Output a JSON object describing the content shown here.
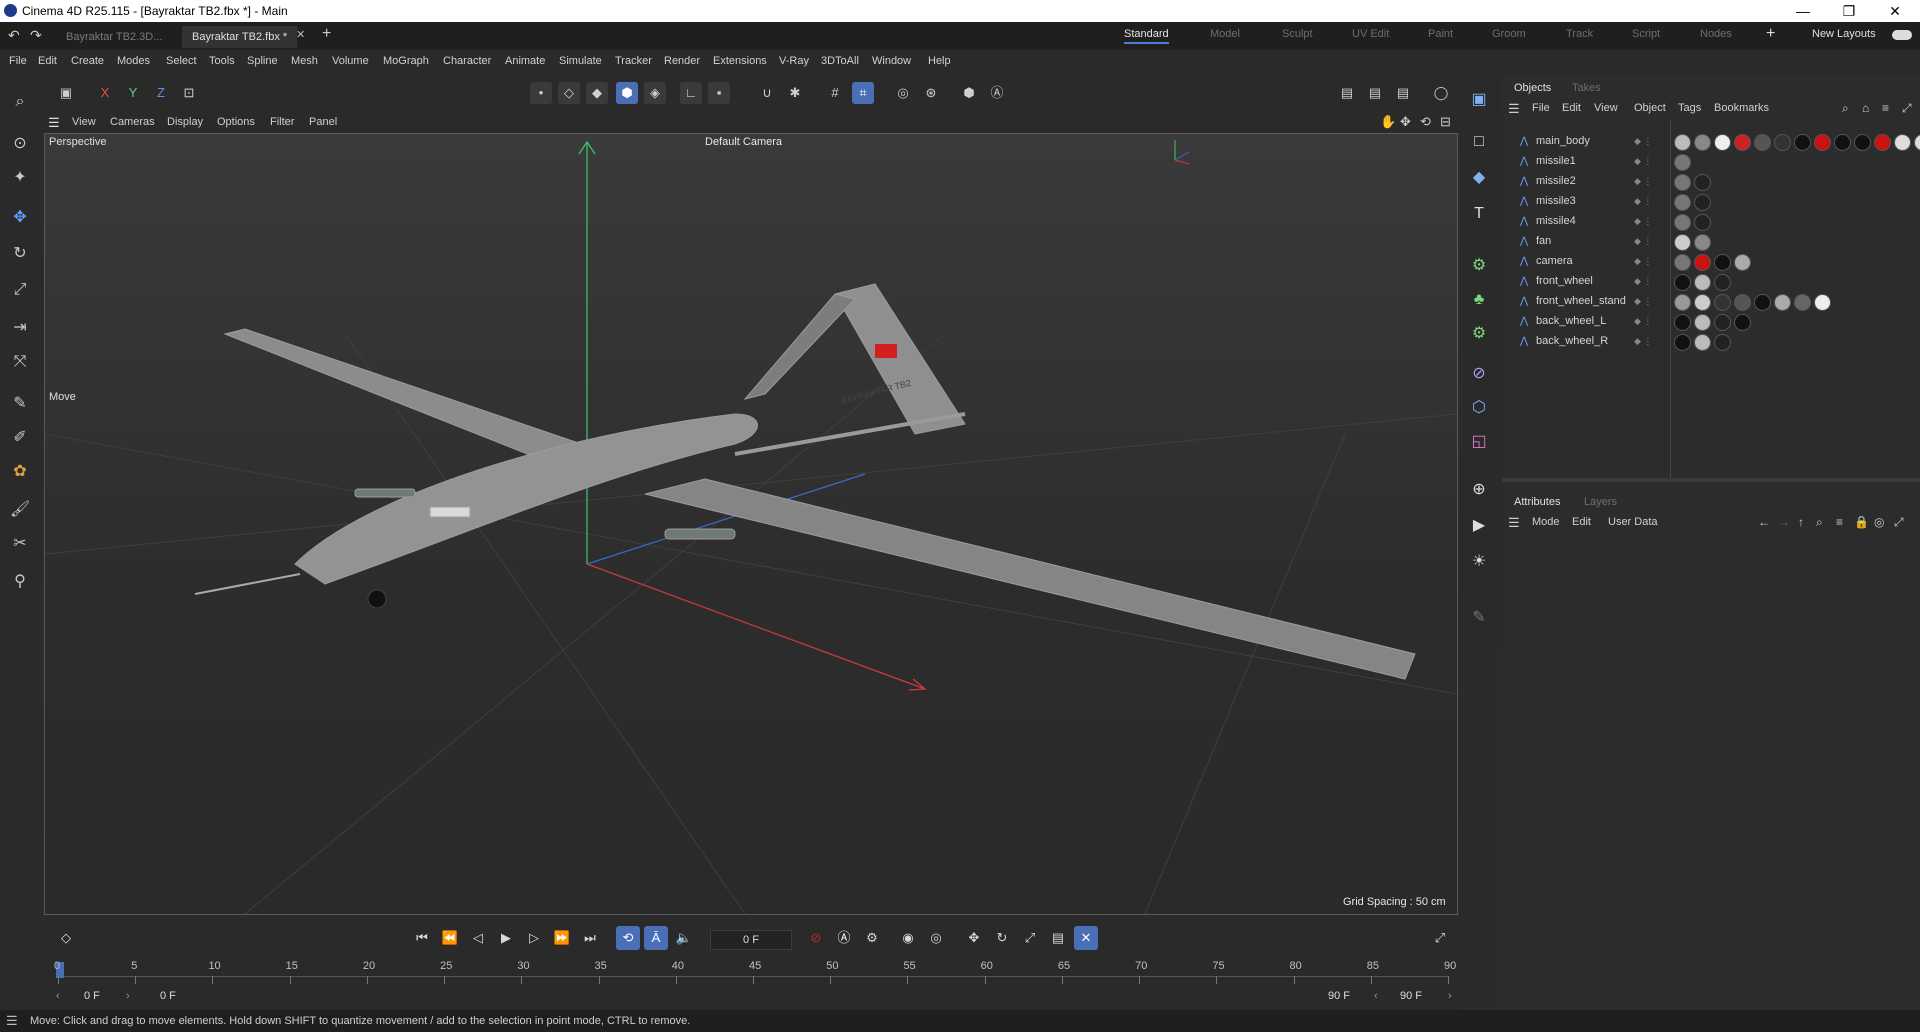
{
  "window": {
    "title": "Cinema 4D R25.115 - [Bayraktar TB2.fbx *] - Main",
    "minimize": "—",
    "maximize": "❐",
    "close": "✕"
  },
  "doc_tabs": [
    {
      "label": "Bayraktar TB2.3D..."
    },
    {
      "label": "Bayraktar TB2.fbx *"
    }
  ],
  "layout_tabs": [
    "Standard",
    "Model",
    "Sculpt",
    "UV Edit",
    "Paint",
    "Groom",
    "Track",
    "Script",
    "Nodes"
  ],
  "new_layouts": "New Layouts",
  "menu": [
    "File",
    "Edit",
    "Create",
    "Modes",
    "Select",
    "Tools",
    "Spline",
    "Mesh",
    "Volume",
    "MoGraph",
    "Character",
    "Animate",
    "Simulate",
    "Tracker",
    "Render",
    "Extensions",
    "V-Ray",
    "3DToAll",
    "Window",
    "Help"
  ],
  "toolbar": {
    "axis_x": "X",
    "axis_y": "Y",
    "axis_z": "Z"
  },
  "viewport": {
    "menu": [
      "View",
      "Cameras",
      "Display",
      "Options",
      "Filter",
      "Panel"
    ],
    "mode_label": "Perspective",
    "camera_label": "Default Camera",
    "tool_label": "Move",
    "grid_spacing": "Grid Spacing : 50 cm",
    "flag_text": "BAYRAKTAR TB2"
  },
  "objects_panel": {
    "tabs": [
      "Objects",
      "Takes"
    ],
    "menu": [
      "File",
      "Edit",
      "View",
      "Object",
      "Tags",
      "Bookmarks"
    ],
    "objects": [
      {
        "name": "main_body",
        "tags": [
          "#bbbbbb",
          "#888888",
          "#eeeeee",
          "#cc2222",
          "#555555",
          "#333333",
          "#111111",
          "#cc1111",
          "#111111",
          "#111111",
          "#cc1111",
          "#dddddd",
          "#dddddd"
        ]
      },
      {
        "name": "missile1",
        "tags": [
          "#777777"
        ]
      },
      {
        "name": "missile2",
        "tags": [
          "#777777",
          "#222222"
        ]
      },
      {
        "name": "missile3",
        "tags": [
          "#777777",
          "#222222"
        ]
      },
      {
        "name": "missile4",
        "tags": [
          "#777777",
          "#222222"
        ]
      },
      {
        "name": "fan",
        "tags": [
          "#cccccc",
          "#888888"
        ]
      },
      {
        "name": "camera",
        "tags": [
          "#777777",
          "#cc1111",
          "#111111",
          "#aaaaaa"
        ]
      },
      {
        "name": "front_wheel",
        "tags": [
          "#111111",
          "#bbbbbb",
          "#222222"
        ]
      },
      {
        "name": "front_wheel_stand",
        "tags": [
          "#999999",
          "#cccccc",
          "#333333",
          "#555555",
          "#111111",
          "#aaaaaa",
          "#666666",
          "#eeeeee"
        ]
      },
      {
        "name": "back_wheel_L",
        "tags": [
          "#111111",
          "#bbbbbb",
          "#222222",
          "#111111"
        ]
      },
      {
        "name": "back_wheel_R",
        "tags": [
          "#111111",
          "#bbbbbb",
          "#222222"
        ]
      }
    ]
  },
  "attributes_panel": {
    "tabs": [
      "Attributes",
      "Layers"
    ],
    "menu": [
      "Mode",
      "Edit",
      "User Data"
    ]
  },
  "timeline": {
    "current_frame": "0 F",
    "start_frame": "0 F",
    "start_frame_field": "0 F",
    "end_frame": "90 F",
    "end_frame_field": "90 F",
    "ticks": [
      "0",
      "5",
      "10",
      "15",
      "20",
      "25",
      "30",
      "35",
      "40",
      "45",
      "50",
      "55",
      "60",
      "65",
      "70",
      "75",
      "80",
      "85",
      "90"
    ]
  },
  "status": {
    "message": "Move: Click and drag to move elements. Hold down SHIFT to quantize movement / add to the selection in point mode, CTRL to remove."
  },
  "colors": {
    "accent": "#4b6fb7",
    "axis_x": "#d23b3b",
    "axis_y": "#3cc86a",
    "axis_z": "#3b6ad2",
    "flag": "#d21f1f"
  }
}
